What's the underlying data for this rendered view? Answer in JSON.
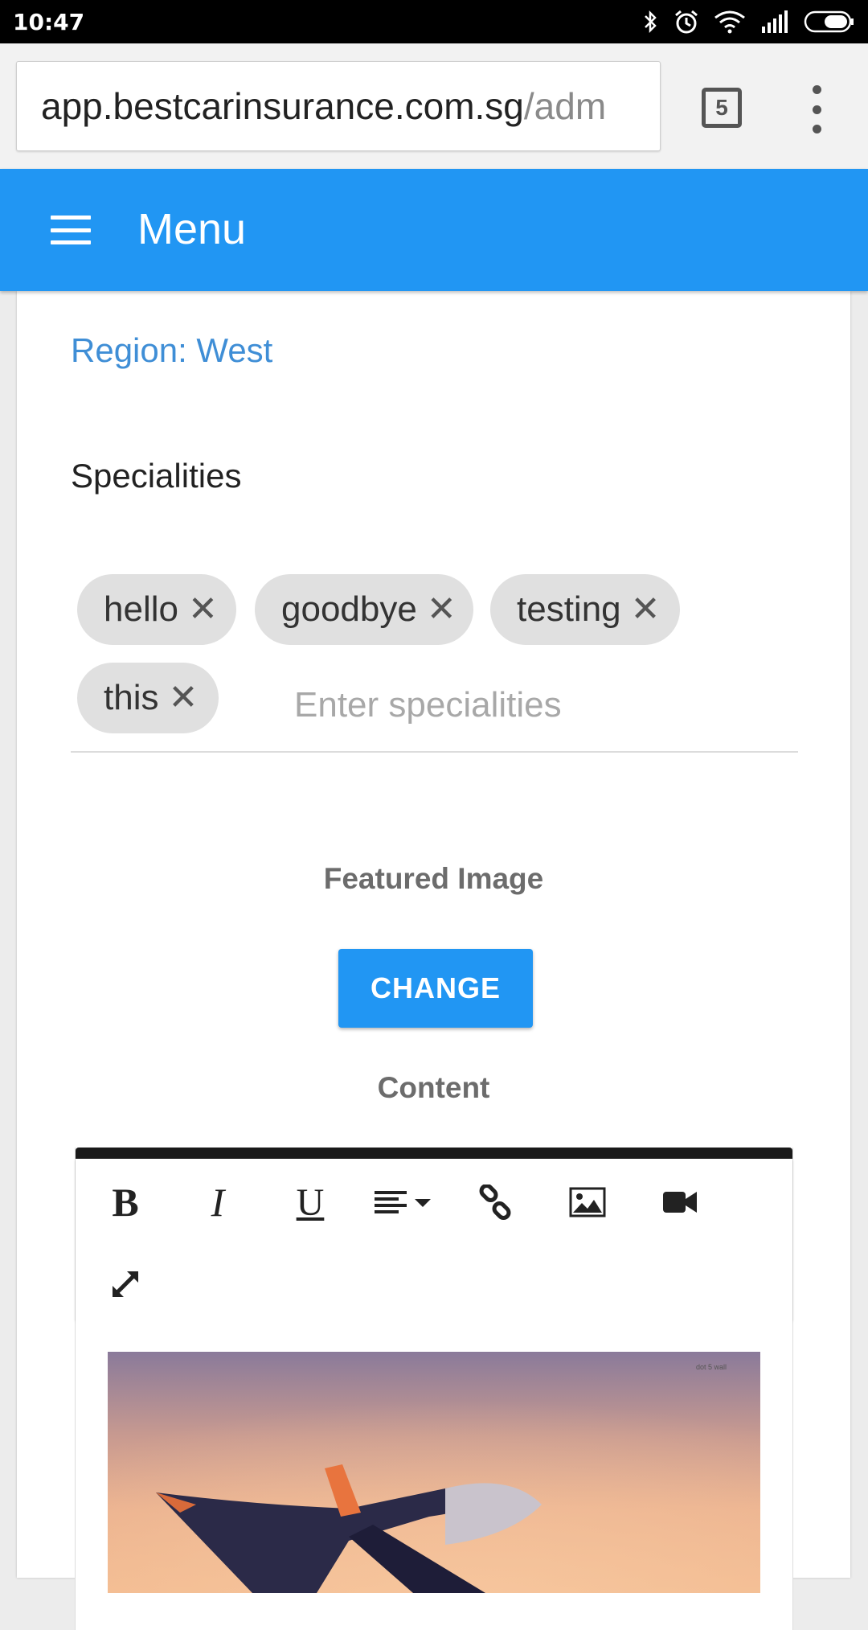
{
  "status_bar": {
    "time": "10:47"
  },
  "browser": {
    "url_host": "app.bestcarinsurance.com.sg",
    "url_path": "/adm",
    "tab_count": "5"
  },
  "app_bar": {
    "title": "Menu"
  },
  "form": {
    "region_text": "Region: West",
    "specialities_label": "Specialities",
    "chips": [
      {
        "label": "hello",
        "remove": "✕"
      },
      {
        "label": "goodbye",
        "remove": "✕"
      },
      {
        "label": "testing",
        "remove": "✕"
      },
      {
        "label": "this",
        "remove": "✕"
      }
    ],
    "specialities_placeholder": "Enter specialities",
    "featured_image_label": "Featured Image",
    "change_button": "CHANGE",
    "content_label": "Content"
  },
  "editor": {
    "toolbar": {
      "bold": "B",
      "italic": "I",
      "underline": "U",
      "icons": [
        "align-icon",
        "link-icon",
        "image-icon",
        "video-icon",
        "fullscreen-icon"
      ]
    },
    "image_watermark": "dot 5 wall"
  }
}
